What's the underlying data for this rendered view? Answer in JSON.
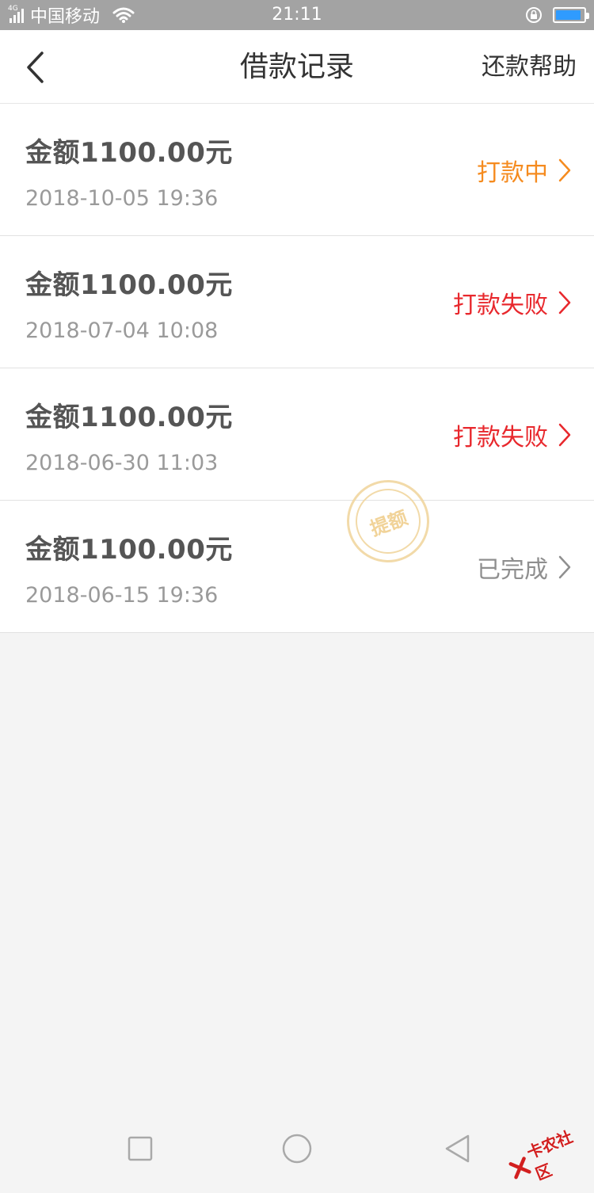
{
  "status_bar": {
    "network": "4G",
    "carrier": "中国移动",
    "time": "21:11",
    "battery_level": 0.9,
    "battery_color": "#2f9bff"
  },
  "nav": {
    "title": "借款记录",
    "help": "还款帮助"
  },
  "records": [
    {
      "amount": "金额1100.00元",
      "datetime": "2018-10-05 19:36",
      "status": "打款中",
      "status_color": "#f58b1f"
    },
    {
      "amount": "金额1100.00元",
      "datetime": "2018-07-04 10:08",
      "status": "打款失败",
      "status_color": "#e8282d"
    },
    {
      "amount": "金额1100.00元",
      "datetime": "2018-06-30 11:03",
      "status": "打款失败",
      "status_color": "#e8282d"
    },
    {
      "amount": "金额1100.00元",
      "datetime": "2018-06-15 19:36",
      "status": "已完成",
      "status_color": "#8f8f8f"
    }
  ],
  "stamp": "提额",
  "watermark": "卡农社区"
}
